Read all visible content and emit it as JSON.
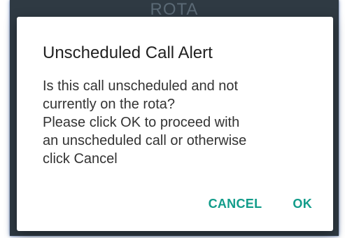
{
  "background": {
    "title": "ROTA"
  },
  "dialog": {
    "title": "Unscheduled Call Alert",
    "message": "Is this call unscheduled and not\ncurrently on the rota?\nPlease click OK to proceed with\nan unscheduled call or otherwise\nclick Cancel",
    "cancel_label": "CANCEL",
    "ok_label": "OK"
  },
  "colors": {
    "accent": "#129c8a",
    "backdrop": "#2f3a43"
  }
}
